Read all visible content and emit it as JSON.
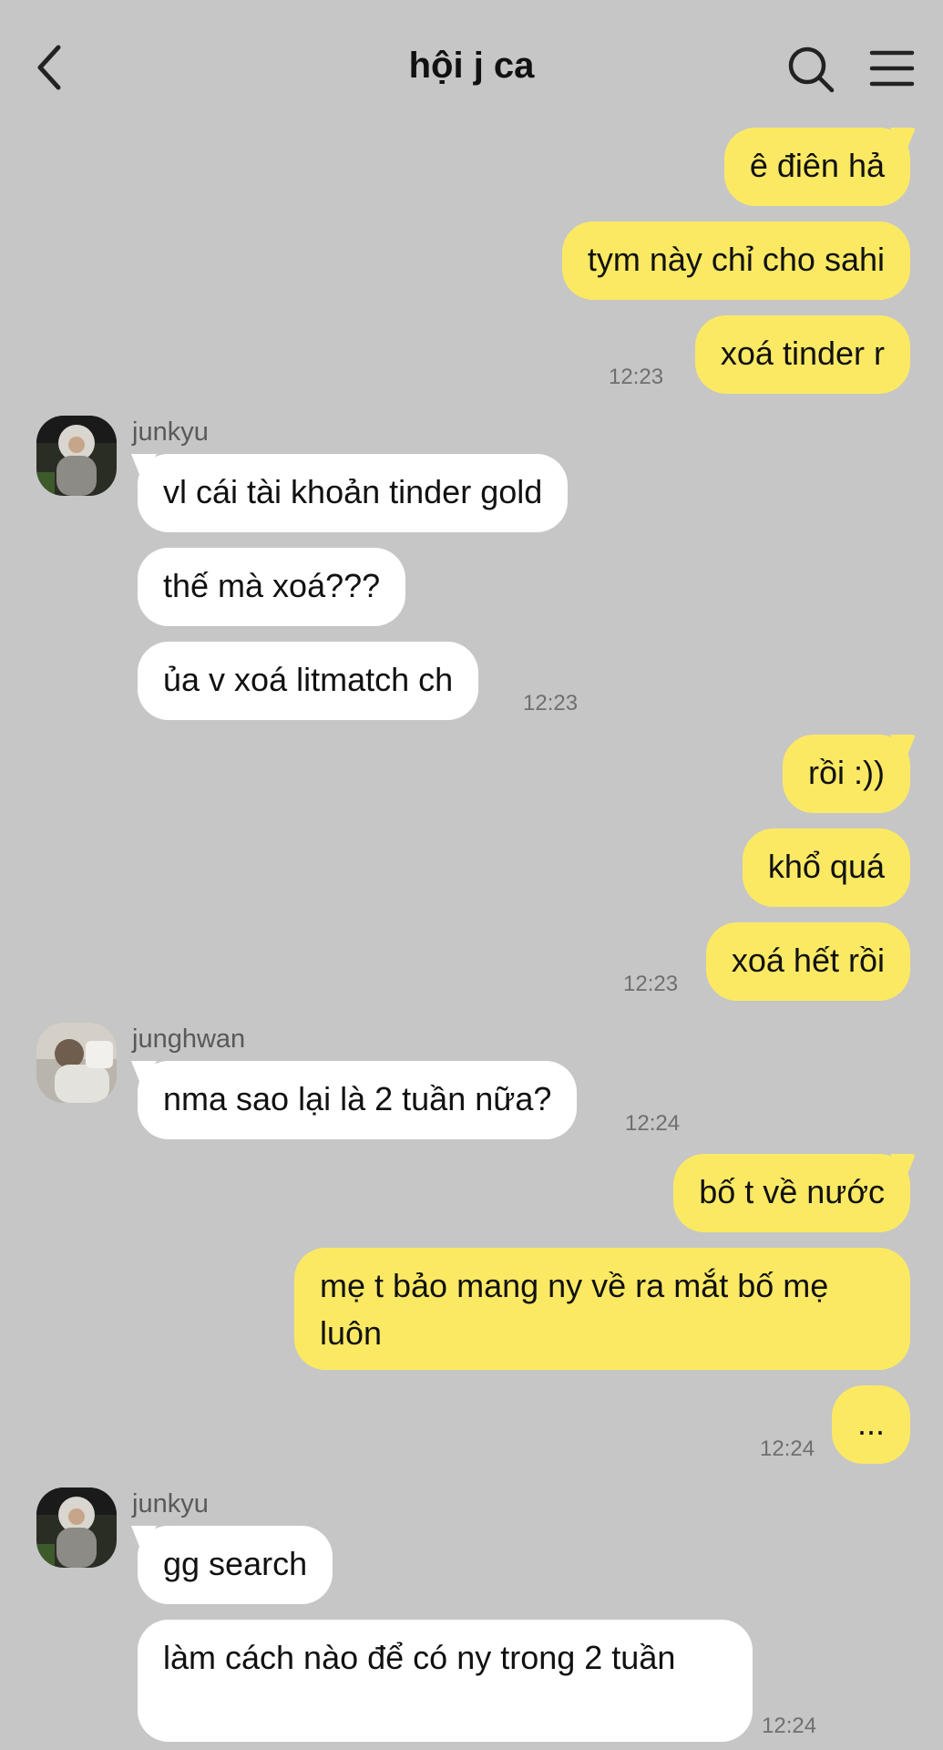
{
  "header": {
    "title": "hội j ca",
    "back_icon": "chevron-left-icon",
    "search_icon": "search-icon",
    "menu_icon": "hamburger-menu-icon"
  },
  "colors": {
    "background": "#c6c6c6",
    "outgoing_bubble": "#fbe964",
    "incoming_bubble": "#ffffff",
    "timestamp": "#6f6f6f"
  },
  "messages": {
    "group1": [
      "ê điên hả",
      "tym này chỉ cho sahi",
      "xoá tinder r"
    ],
    "group1_time": "12:23",
    "group2_sender": "junkyu",
    "group2": [
      "vl cái tài khoản tinder gold",
      "thế mà xoá???",
      "ủa v xoá litmatch ch"
    ],
    "group2_time": "12:23",
    "group3": [
      "rồi :))",
      "khổ quá",
      "xoá hết rồi"
    ],
    "group3_time": "12:23",
    "group4_sender": "junghwan",
    "group4": [
      "nma sao lại là 2 tuần nữa?"
    ],
    "group4_time": "12:24",
    "group5": [
      "bố t về nước",
      "mẹ t bảo mang ny về ra mắt bố mẹ luôn",
      "..."
    ],
    "group5_time": "12:24",
    "group6_sender": "junkyu",
    "group6": [
      "gg search",
      "làm cách nào để có ny trong 2 tuần"
    ],
    "group6_time": "12:24"
  }
}
